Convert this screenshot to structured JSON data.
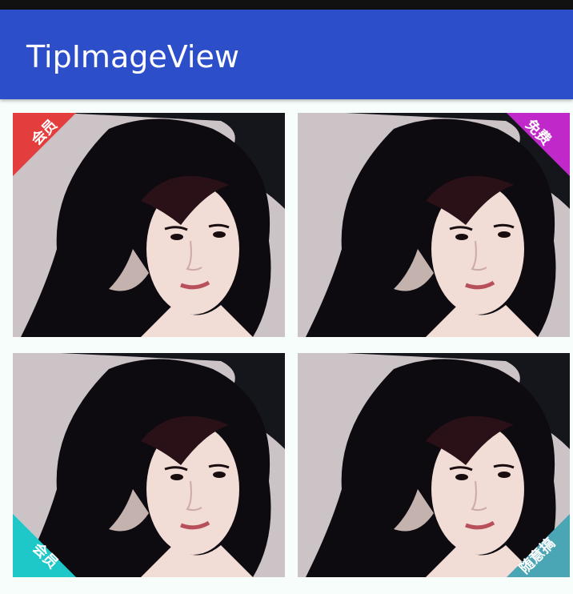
{
  "app": {
    "title": "TipImageView"
  },
  "grid": {
    "items": [
      {
        "tip_label": "会员",
        "tip_corner": "top-left",
        "tip_color": "#e33d3d"
      },
      {
        "tip_label": "免费",
        "tip_corner": "top-right",
        "tip_color": "#c128c9"
      },
      {
        "tip_label": "会员",
        "tip_corner": "bottom-left",
        "tip_color": "#1ec8c8"
      },
      {
        "tip_label": "随意搞",
        "tip_corner": "bottom-right",
        "tip_color": "#4aa5b5"
      }
    ]
  }
}
